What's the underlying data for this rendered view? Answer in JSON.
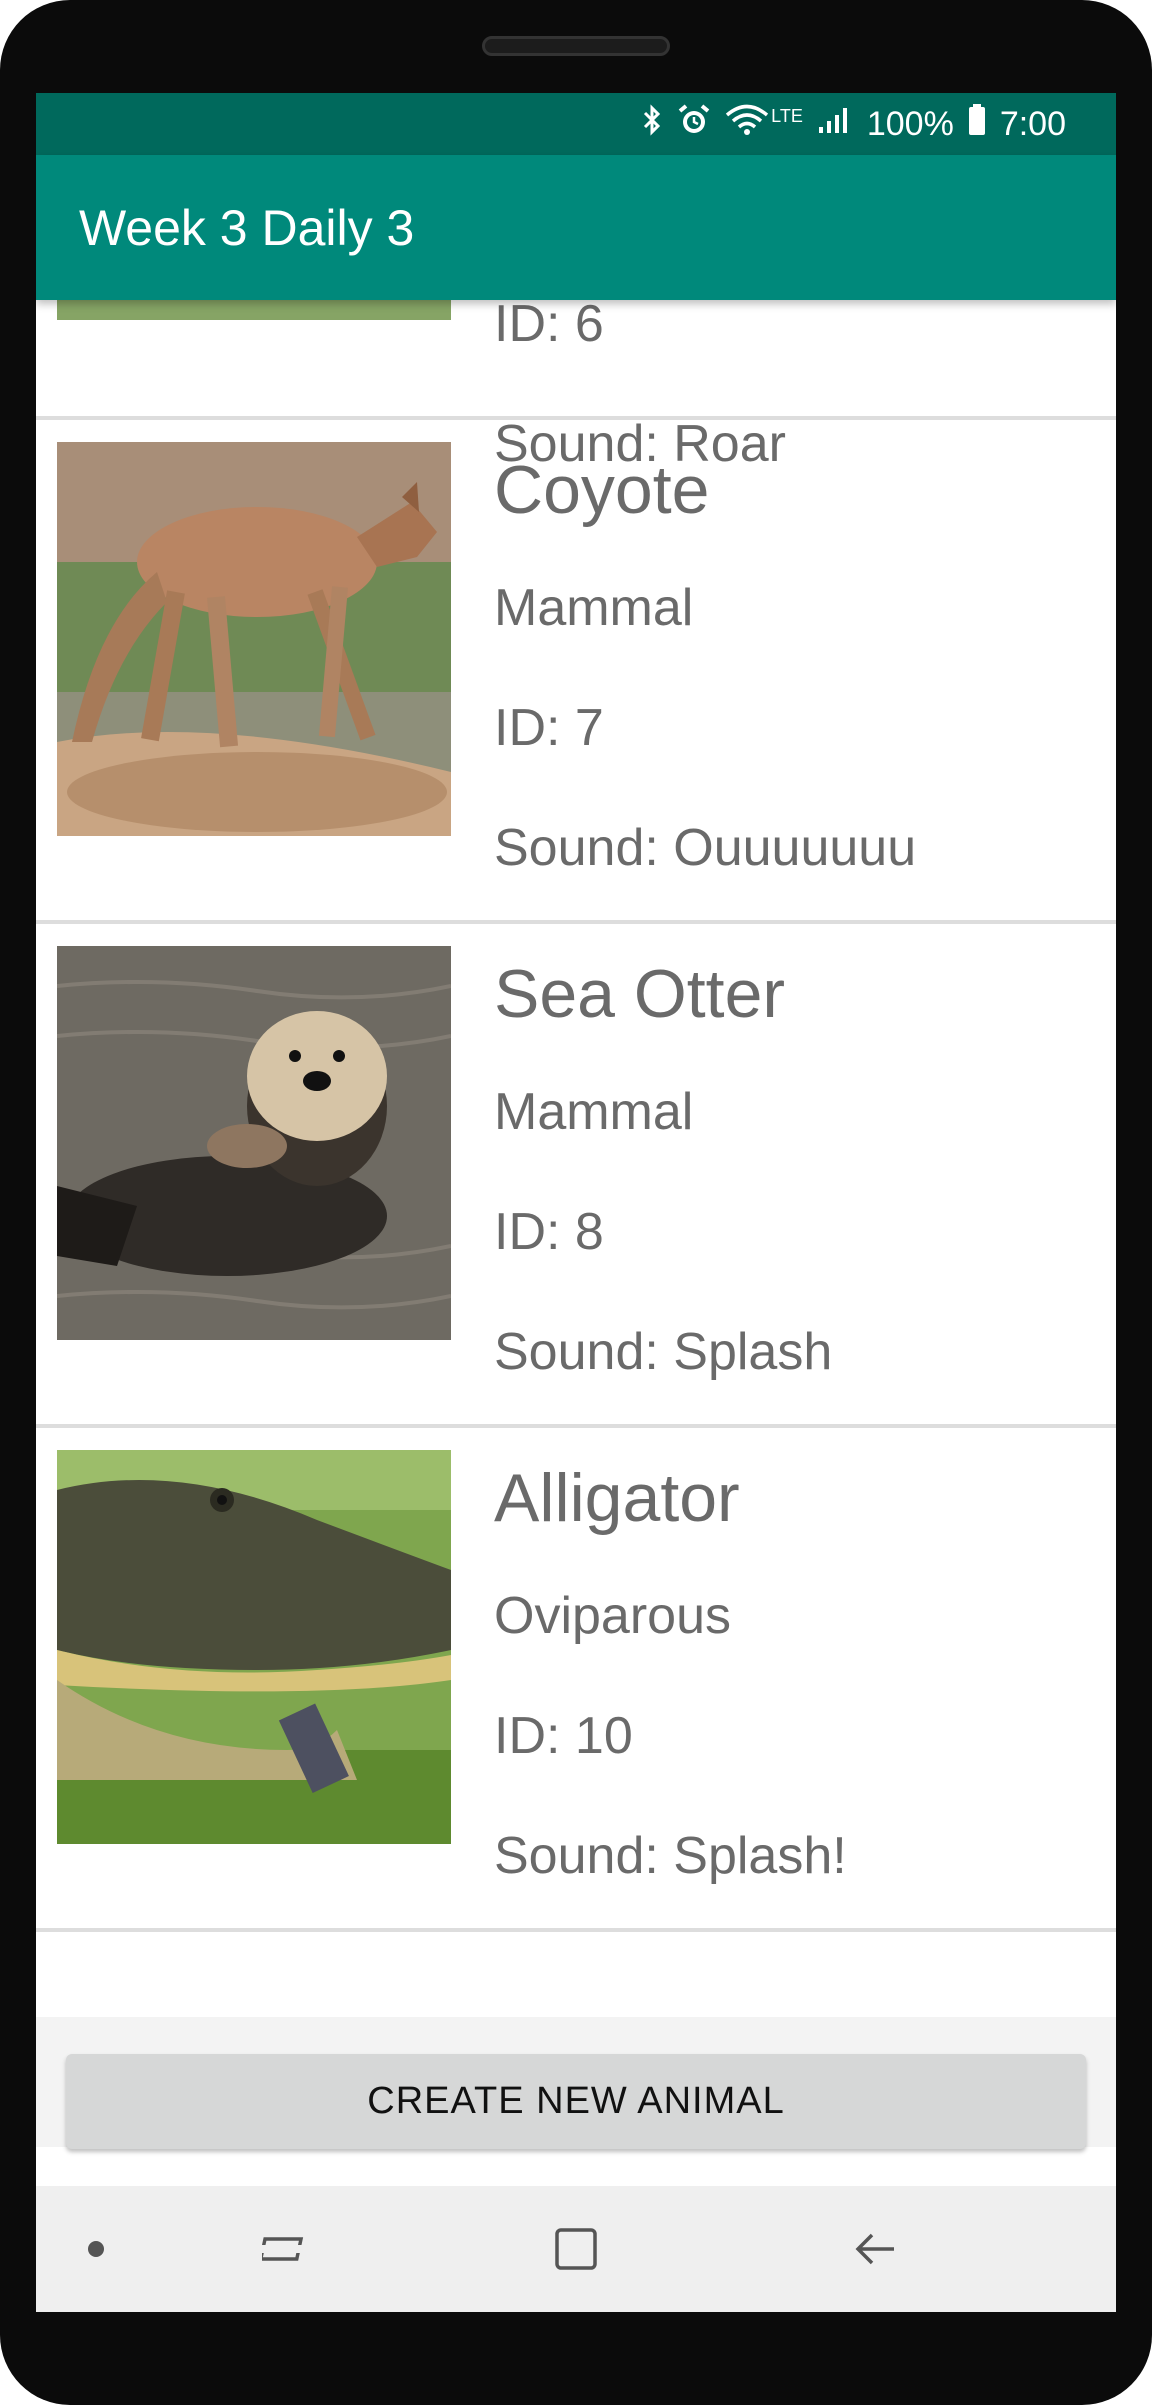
{
  "status_bar": {
    "battery": "100%",
    "time": "7:00",
    "network": "LTE"
  },
  "app_bar": {
    "title": "Week 3 Daily 3"
  },
  "animals": [
    {
      "id_text": "ID: 6",
      "sound": "Sound: Roar",
      "image": "bears-grass-photo"
    },
    {
      "name": "Coyote",
      "type": "Mammal",
      "id_text": "ID: 7",
      "sound": "Sound: Ouuuuuuu",
      "image": "coyote-photo"
    },
    {
      "name": "Sea Otter",
      "type": "Mammal",
      "id_text": "ID: 8",
      "sound": "Sound: Splash",
      "image": "sea-otter-photo"
    },
    {
      "name": "Alligator",
      "type": "Oviparous",
      "id_text": "ID: 10",
      "sound": "Sound: Splash!",
      "image": "alligator-photo"
    }
  ],
  "actions": {
    "create_label": "CREATE NEW ANIMAL"
  },
  "nav_bar": {
    "items": [
      "dot-icon",
      "recent-apps-icon",
      "home-icon",
      "back-icon"
    ]
  },
  "colors": {
    "app_bar": "#00897b",
    "status_bar": "#00695c",
    "button": "#d6d7d7"
  }
}
